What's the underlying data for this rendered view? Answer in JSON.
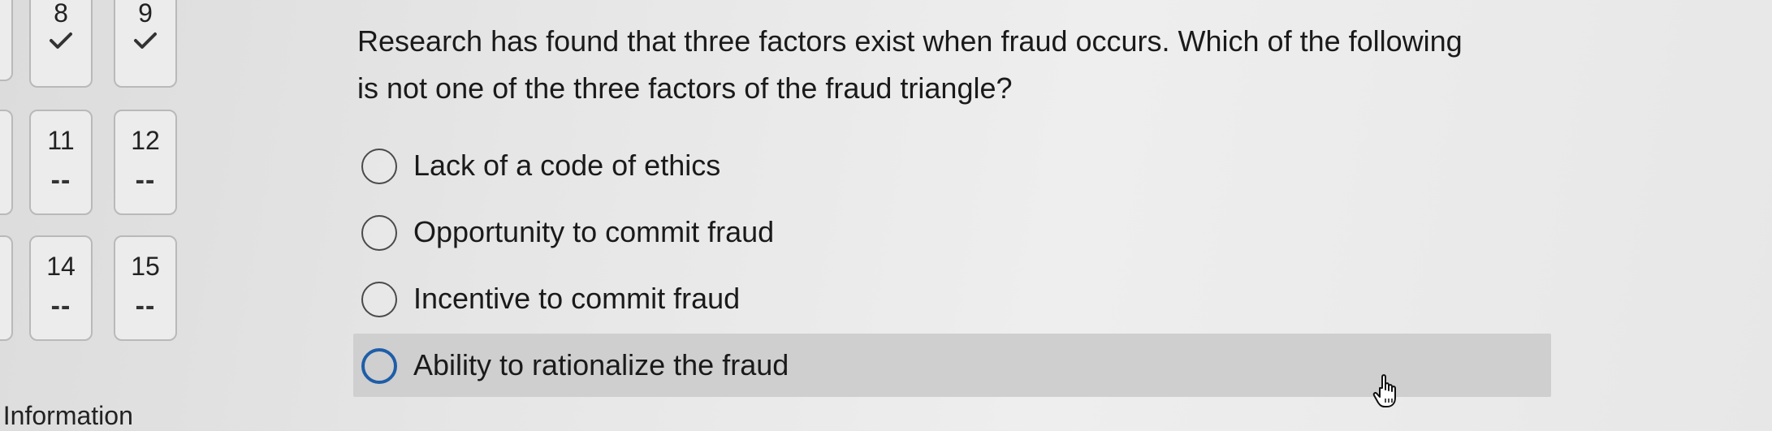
{
  "navigator": {
    "row1": [
      {
        "number": "8",
        "status": "answered"
      },
      {
        "number": "9",
        "status": "answered"
      }
    ],
    "row2": [
      {
        "number": "11",
        "status_text": "--"
      },
      {
        "number": "12",
        "status_text": "--"
      }
    ],
    "row3": [
      {
        "number": "14",
        "status_text": "--"
      },
      {
        "number": "15",
        "status_text": "--"
      }
    ]
  },
  "info_label": ": Information",
  "question": {
    "text": "Research has found that three factors exist when fraud occurs. Which of the following is not one of the three factors of the fraud triangle?",
    "options": [
      {
        "label": "Lack of a code of ethics"
      },
      {
        "label": "Opportunity to commit fraud"
      },
      {
        "label": "Incentive to commit fraud"
      },
      {
        "label": "Ability to rationalize the fraud",
        "hovered": true
      }
    ]
  },
  "colors": {
    "radio_focus": "#1f5ea8",
    "hover_bg": "#cfcfcf"
  },
  "icons": {
    "answered": "checkmark-icon",
    "cursor": "hand-pointer-icon"
  }
}
